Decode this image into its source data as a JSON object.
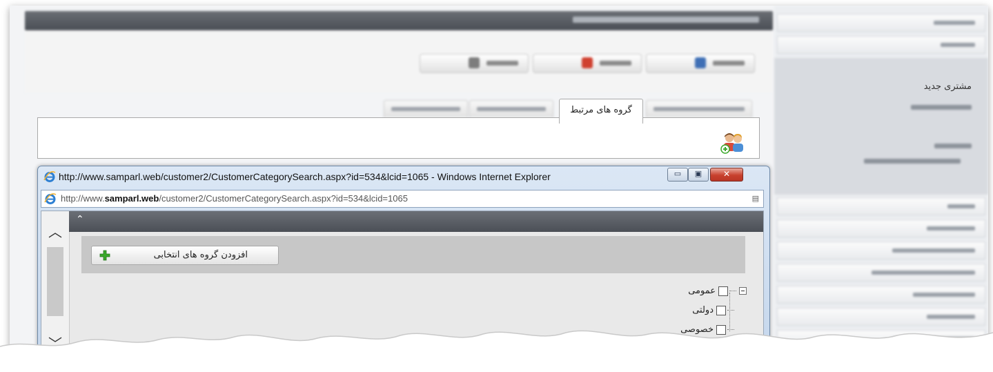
{
  "background_app": {
    "active_tab_label": "گروه های مرتبط",
    "sidebar_new_customer": "مشتری جدید"
  },
  "popup": {
    "title": "http://www.samparl.web/customer2/CustomerCategorySearch.aspx?id=534&lcid=1065 - Windows Internet Explorer",
    "address": {
      "prefix": "http://www.",
      "domain": "samparl.web",
      "path": "/customer2/CustomerCategorySearch.aspx?id=534&lcid=1065"
    },
    "add_selected_groups_label": "افزودن گروه های انتخابی",
    "tree": {
      "root": "عمومی",
      "children": [
        "دولتی",
        "خصوصی"
      ]
    }
  },
  "colors": {
    "window_chrome": "#c4d6ec",
    "close_button": "#c8412e",
    "dark_bar": "#4b4f56",
    "add_icon": "#3aa82b"
  },
  "icons": [
    "add-users-icon",
    "ie-logo-icon",
    "minimize-icon",
    "maximize-icon",
    "close-icon",
    "plus-icon",
    "scroll-up-icon",
    "scroll-down-icon",
    "collapse-caret-icon",
    "tree-expander-icon"
  ]
}
